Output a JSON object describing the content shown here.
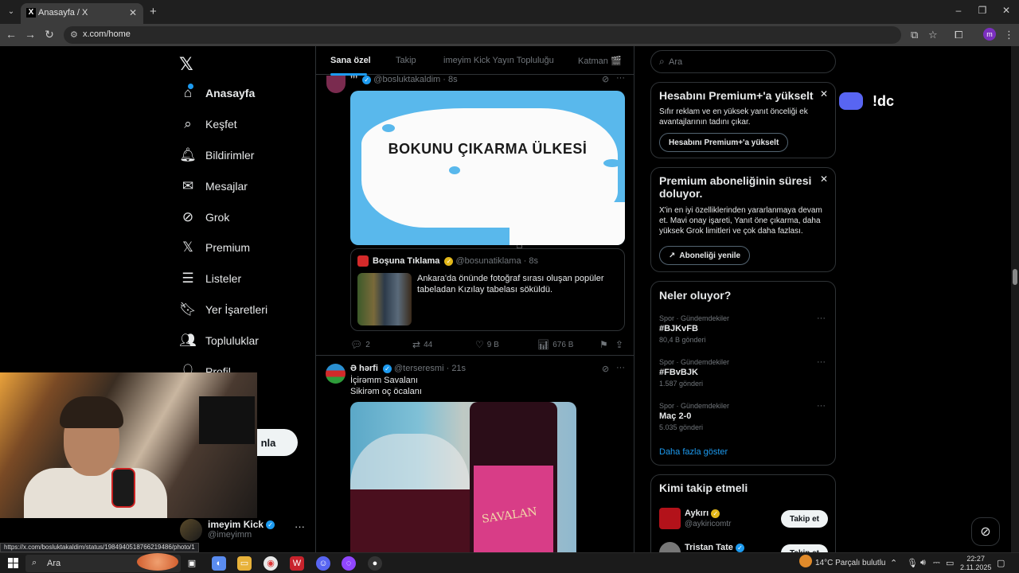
{
  "browser": {
    "tab_title": "Anasayfa / X",
    "url": "x.com/home",
    "status_url": "https://x.com/bosluktakaldim/status/1984940518766219486/photo/1"
  },
  "nav": {
    "items": [
      {
        "label": "Anasayfa",
        "icon": "home-icon"
      },
      {
        "label": "Keşfet",
        "icon": "search-icon"
      },
      {
        "label": "Bildirimler",
        "icon": "bell-icon"
      },
      {
        "label": "Mesajlar",
        "icon": "mail-icon"
      },
      {
        "label": "Grok",
        "icon": "grok-icon"
      },
      {
        "label": "Premium",
        "icon": "x-icon"
      },
      {
        "label": "Listeler",
        "icon": "list-icon"
      },
      {
        "label": "Yer İşaretleri",
        "icon": "bookmark-icon"
      },
      {
        "label": "Topluluklar",
        "icon": "people-icon"
      },
      {
        "label": "Profil",
        "icon": "person-icon"
      }
    ],
    "post_button_partial": "nla",
    "account": {
      "name": "imeyim Kick",
      "handle": "@imeyimm"
    }
  },
  "feed": {
    "tabs": [
      "Sana özel",
      "Takip",
      "imeyim Kick Yayın Topluluğu",
      "Katman 🎬"
    ],
    "tweet1": {
      "name": "ʼʼʼ",
      "handle": "@bosluktakaldim",
      "time": "8s",
      "map_title": "BOKUNU ÇIKARMA ÜLKESİ",
      "quote": {
        "name": "Boşuna Tıklama",
        "handle": "@bosunatiklama",
        "time": "8s",
        "text": "Ankara'da önünde fotoğraf sırası oluşan popüler tabeladan Kızılay tabelası söküldü."
      },
      "replies": "2",
      "retweets": "44",
      "likes": "9 B",
      "views": "676 B"
    },
    "tweet2": {
      "name": "Ə hərfi",
      "handle": "@terseresmi",
      "time": "21s",
      "line1": "İçirəmm  Savalanı",
      "line2": "Sikirəm oç öcalanı",
      "bottle_label": "SAVALAN"
    }
  },
  "sidebar": {
    "search_placeholder": "Ara",
    "premium_plus": {
      "title": "Hesabını Premium+'a yükselt",
      "body": "Sıfır reklam ve en yüksek yanıt önceliği ek avantajlarının tadını çıkar.",
      "button": "Hesabını Premium+'a yükselt"
    },
    "premium_expire": {
      "title": "Premium aboneliğinin süresi doluyor.",
      "body": "X'in en iyi özelliklerinden yararlanmaya devam et. Mavi onay işareti, Yanıt öne çıkarma, daha yüksek Grok limitleri ve çok daha fazlası.",
      "button": "Aboneliği yenile"
    },
    "trends": {
      "title": "Neler oluyor?",
      "items": [
        {
          "category": "Spor · Gündemdekiler",
          "name": "#BJKvFB",
          "count": "80,4 B gönderi"
        },
        {
          "category": "Spor · Gündemdekiler",
          "name": "#FBvBJK",
          "count": "1.587 gönderi"
        },
        {
          "category": "Spor · Gündemdekiler",
          "name": "Maç 2-0",
          "count": "5.035 gönderi"
        }
      ],
      "show_more": "Daha fazla göster"
    },
    "who_to_follow": {
      "title": "Kimi takip etmeli",
      "items": [
        {
          "name": "Aykırı",
          "handle": "@aykiricomtr",
          "button": "Takip et"
        },
        {
          "name": "Tristan Tate",
          "handle": "",
          "button": "Takip et"
        }
      ]
    }
  },
  "overlay": {
    "discord_text": "!dc"
  },
  "taskbar": {
    "search": "Ara",
    "weather": "14°C  Parçalı bulutlu",
    "time": "22:27",
    "date": "2.11.2025"
  }
}
